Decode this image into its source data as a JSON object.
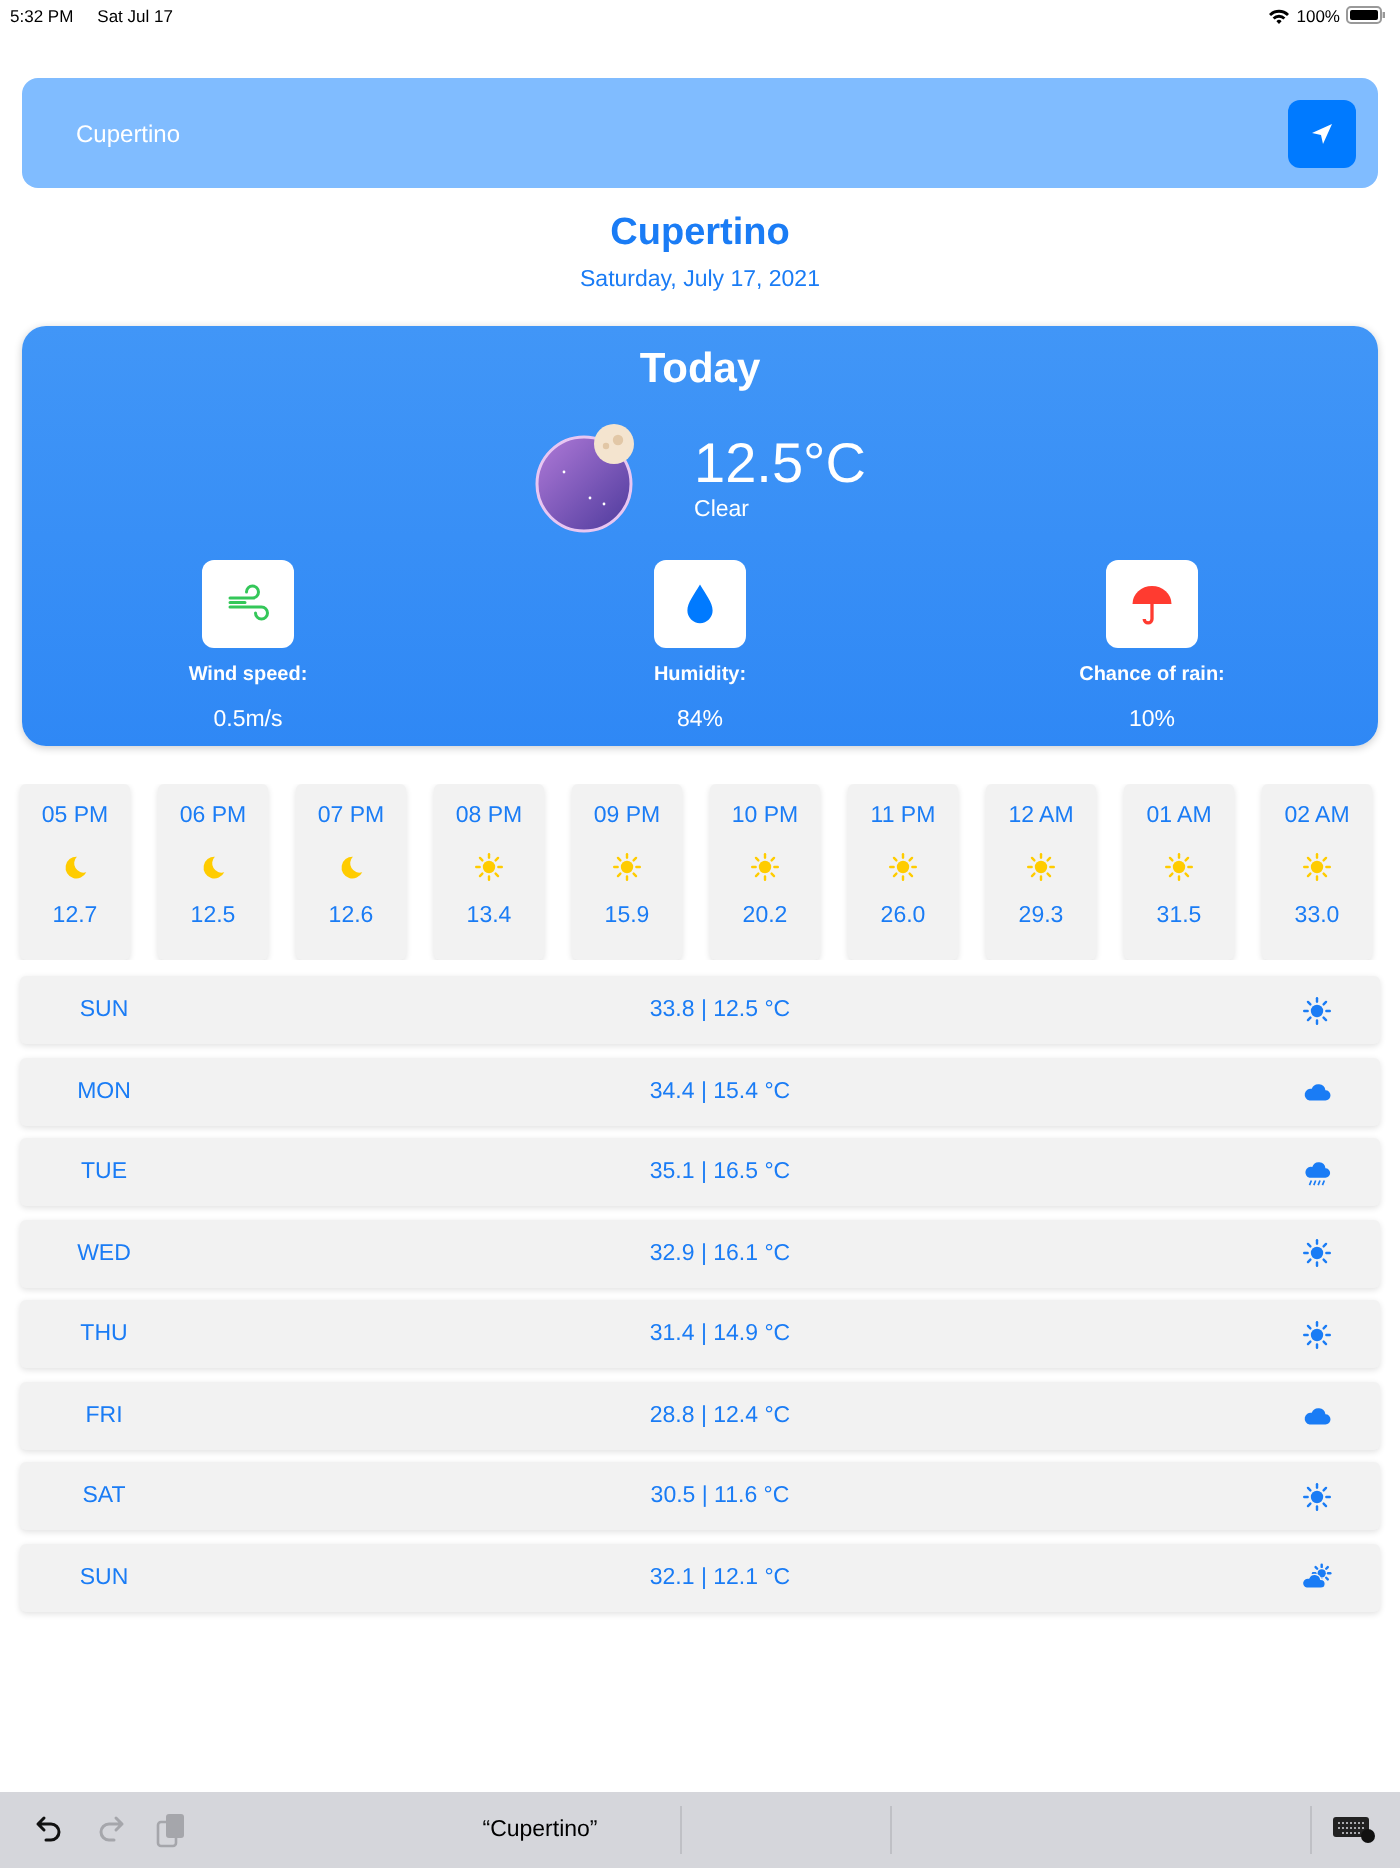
{
  "status_bar": {
    "time": "5:32 PM",
    "date": "Sat Jul 17",
    "battery": "100%"
  },
  "search": {
    "value": "Cupertino"
  },
  "location": {
    "city": "Cupertino",
    "date": "Saturday, July 17, 2021"
  },
  "today": {
    "title": "Today",
    "temperature": "12.5°C",
    "condition": "Clear",
    "stats": [
      {
        "kind": "wind",
        "label": "Wind speed:",
        "value": "0.5m/s"
      },
      {
        "kind": "humidity",
        "label": "Humidity:",
        "value": "84%"
      },
      {
        "kind": "rain",
        "label": "Chance of rain:",
        "value": "10%"
      }
    ]
  },
  "hourly": [
    {
      "time": "05 PM",
      "kind": "moon",
      "temp": "12.7"
    },
    {
      "time": "06 PM",
      "kind": "moon",
      "temp": "12.5"
    },
    {
      "time": "07 PM",
      "kind": "moon",
      "temp": "12.6"
    },
    {
      "time": "08 PM",
      "kind": "sun",
      "temp": "13.4"
    },
    {
      "time": "09 PM",
      "kind": "sun",
      "temp": "15.9"
    },
    {
      "time": "10 PM",
      "kind": "sun",
      "temp": "20.2"
    },
    {
      "time": "11 PM",
      "kind": "sun",
      "temp": "26.0"
    },
    {
      "time": "12 AM",
      "kind": "sun",
      "temp": "29.3"
    },
    {
      "time": "01 AM",
      "kind": "sun",
      "temp": "31.5"
    },
    {
      "time": "02 AM",
      "kind": "sun",
      "temp": "33.0"
    }
  ],
  "daily": [
    {
      "day": "SUN",
      "temps": "33.8 | 12.5 °C",
      "kind": "sun"
    },
    {
      "day": "MON",
      "temps": "34.4 | 15.4 °C",
      "kind": "cloud"
    },
    {
      "day": "TUE",
      "temps": "35.1 | 16.5 °C",
      "kind": "rain"
    },
    {
      "day": "WED",
      "temps": "32.9 | 16.1 °C",
      "kind": "sun"
    },
    {
      "day": "THU",
      "temps": "31.4 | 14.9 °C",
      "kind": "sun"
    },
    {
      "day": "FRI",
      "temps": "28.8 | 12.4 °C",
      "kind": "cloud"
    },
    {
      "day": "SAT",
      "temps": "30.5 | 11.6 °C",
      "kind": "sun"
    },
    {
      "day": "SUN",
      "temps": "32.1 | 12.1 °C",
      "kind": "partly-cloudy"
    }
  ],
  "keyboard_bar": {
    "tools": [
      {
        "kind": "undo",
        "disabled": false
      },
      {
        "kind": "redo",
        "disabled": true
      },
      {
        "kind": "paste",
        "disabled": true
      }
    ],
    "suggestion": "“Cupertino”"
  }
}
